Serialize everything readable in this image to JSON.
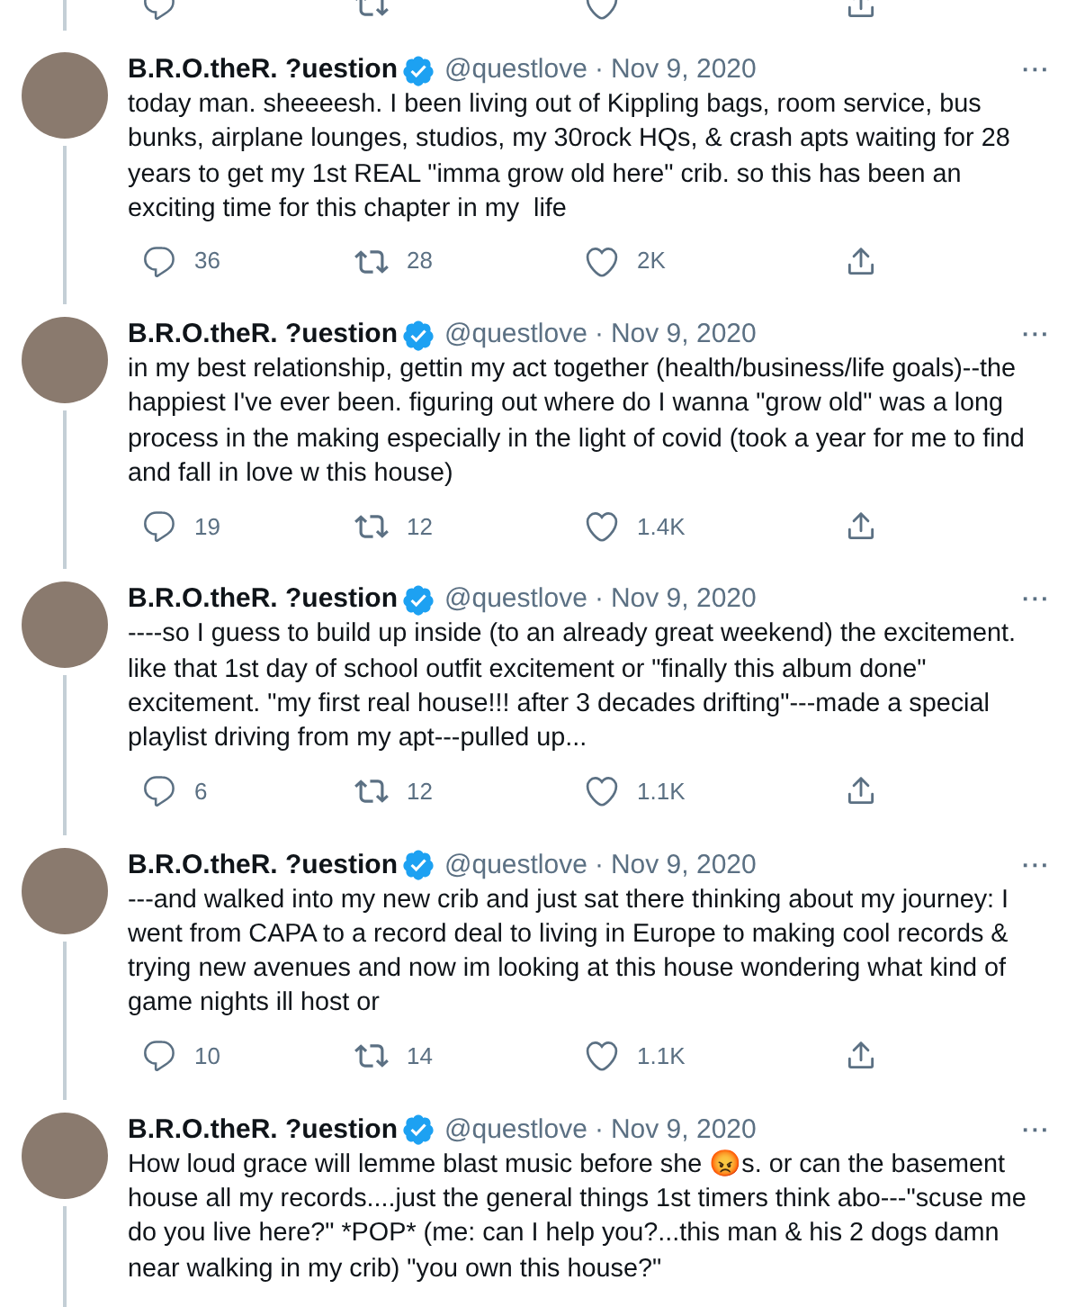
{
  "tweets": [
    {
      "name": "B.R.O.theR. ?uestion",
      "verified": true,
      "handle": "@questlove",
      "separator": "·",
      "date": "Nov 9, 2020",
      "more": "···",
      "text": "today man. sheeeesh. I been living out of Kippling bags, room service, bus bunks, airplane lounges, studios, my 30rock HQs, & crash apts waiting for 28 years to get my 1st REAL \"imma grow old here\" crib. so this has been an exciting time for this chapter in my  life",
      "replies": "36",
      "retweets": "28",
      "likes": "2K",
      "thread_continues": true
    },
    {
      "name": "B.R.O.theR. ?uestion",
      "verified": true,
      "handle": "@questlove",
      "separator": "·",
      "date": "Nov 9, 2020",
      "more": "···",
      "text": "in my best relationship, gettin my act together (health/business/life goals)--the happiest I've ever been. figuring out where do I wanna \"grow old\" was a long process in the making especially in the light of covid (took a year for me to find and fall in love w this house)",
      "replies": "19",
      "retweets": "12",
      "likes": "1.4K",
      "thread_continues": true
    },
    {
      "name": "B.R.O.theR. ?uestion",
      "verified": true,
      "handle": "@questlove",
      "separator": "·",
      "date": "Nov 9, 2020",
      "more": "···",
      "text": "----so I guess to build up inside (to an already great weekend) the excitement. like that 1st day of school outfit excitement or \"finally this album done\" excitement. \"my first real house!!! after 3 decades drifting\"---made a special playlist driving from my apt---pulled up...",
      "replies": "6",
      "retweets": "12",
      "likes": "1.1K",
      "thread_continues": true
    },
    {
      "name": "B.R.O.theR. ?uestion",
      "verified": true,
      "handle": "@questlove",
      "separator": "·",
      "date": "Nov 9, 2020",
      "more": "···",
      "text": "---and walked into my new crib and just sat there thinking about my journey: I went from CAPA to a record deal to living in Europe to making cool records & trying new avenues and now im looking at this house wondering what kind of game nights ill host or",
      "replies": "10",
      "retweets": "14",
      "likes": "1.1K",
      "thread_continues": true
    },
    {
      "name": "B.R.O.theR. ?uestion",
      "verified": true,
      "handle": "@questlove",
      "separator": "·",
      "date": "Nov 9, 2020",
      "more": "···",
      "text": "How loud grace will lemme blast music before she 😡s. or can the basement house all my records....just the general things 1st timers think abo---\"scuse me do you live here?\" *POP* (me: can I help you?...this man & his 2 dogs damn near walking in my crib) \"you own this house?\"",
      "thread_continues": true
    }
  ]
}
